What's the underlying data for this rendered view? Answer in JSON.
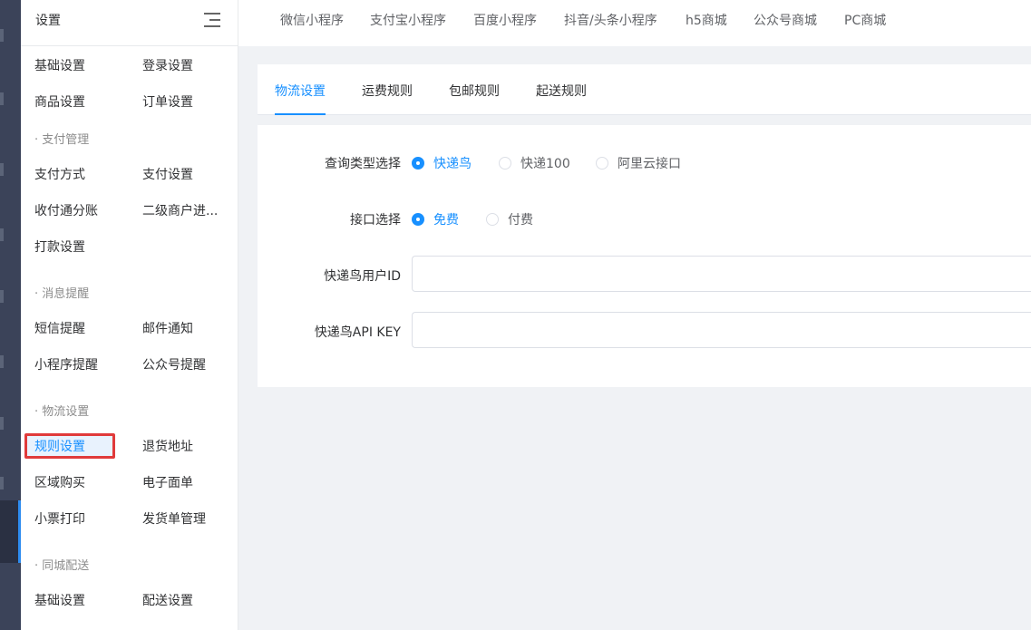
{
  "menu": {
    "title": "设置",
    "rows": [
      [
        "基础设置",
        "登录设置"
      ],
      [
        "商品设置",
        "订单设置"
      ],
      [
        "· 支付管理"
      ],
      [
        "支付方式",
        "支付设置"
      ],
      [
        "收付通分账",
        "二级商户进..."
      ],
      [
        "打款设置"
      ],
      [
        "· 消息提醒"
      ],
      [
        "短信提醒",
        "邮件通知"
      ],
      [
        "小程序提醒",
        "公众号提醒"
      ],
      [
        "· 物流设置"
      ],
      [
        "规则设置",
        "退货地址"
      ],
      [
        "区域购买",
        "电子面单"
      ],
      [
        "小票打印",
        "发货单管理"
      ],
      [
        "· 同城配送"
      ],
      [
        "基础设置",
        "配送设置"
      ]
    ],
    "selected": "规则设置"
  },
  "topbar": {
    "tabs": [
      "微信小程序",
      "支付宝小程序",
      "百度小程序",
      "抖音/头条小程序",
      "h5商城",
      "公众号商城",
      "PC商城"
    ]
  },
  "subtabs": {
    "tabs": [
      "物流设置",
      "运费规则",
      "包邮规则",
      "起送规则"
    ],
    "active": "物流设置"
  },
  "form": {
    "query_type": {
      "label": "查询类型选择",
      "options": [
        "快递鸟",
        "快递100",
        "阿里云接口"
      ],
      "selected": "快递鸟"
    },
    "api_choice": {
      "label": "接口选择",
      "options": [
        "免费",
        "付费"
      ],
      "selected": "免费"
    },
    "user_id": {
      "label": "快递鸟用户ID",
      "value": ""
    },
    "api_key": {
      "label": "快递鸟API KEY",
      "value": ""
    }
  },
  "colors": {
    "accent": "#1890ff",
    "highlight_border": "#e03a3a",
    "rail": "#3b4359"
  }
}
